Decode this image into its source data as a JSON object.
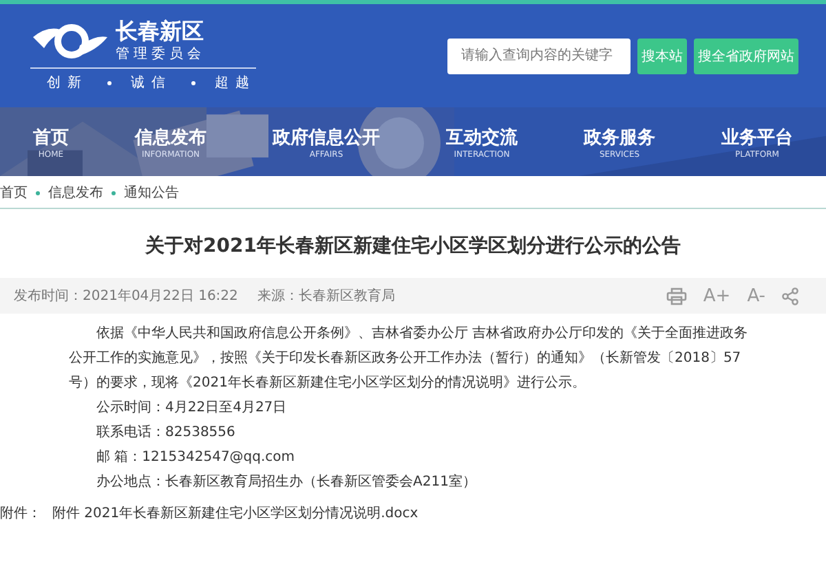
{
  "header": {
    "logo_title": "长春新区",
    "logo_subtitle": "管理委员会",
    "motto": [
      "创新",
      "诚信",
      "超越"
    ],
    "search": {
      "placeholder": "请输入查询内容的关键字"
    },
    "buttons": [
      "搜本站",
      "搜全省政府网站"
    ]
  },
  "nav": [
    {
      "label": "首页",
      "english": "HOME"
    },
    {
      "label": "信息发布",
      "english": "INFORMATION"
    },
    {
      "label": "政府信息公开",
      "english": "AFFAIRS"
    },
    {
      "label": "互动交流",
      "english": "INTERACTION"
    },
    {
      "label": "政务服务",
      "english": "SERVICES"
    },
    {
      "label": "业务平台",
      "english": "PLATFORM"
    }
  ],
  "breadcrumb": [
    "首页",
    "信息发布",
    "通知公告"
  ],
  "article": {
    "title": "关于对2021年长春新区新建住宅小区学区划分进行公示的公告",
    "meta": {
      "published": "发布时间：2021年04月22日 16:22",
      "source": "来源：长春新区教育局"
    },
    "tools": [
      "A+",
      "A-"
    ],
    "paragraph": "依据《中华人民共和国政府信息公开条例》、吉林省委办公厅 吉林省政府办公厅印发的《关于全面推进政务公开工作的实施意见》，按照《关于印发长春新区政务公开工作办法（暂行）的通知》（长新管发〔2018〕57号）的要求，现将《2021年长春新区新建住宅小区学区划分的情况说明》进行公示。",
    "details": [
      "公示时间：4月22日至4月27日",
      "联系电话：82538556",
      "邮 箱：1215342547@qq.com",
      "办公地点：长春新区教育局招生办（长春新区管委会A211室）"
    ],
    "attachment": {
      "label": "附件：",
      "link": "附件 2021年长春新区新建住宅小区学区划分情况说明.docx"
    }
  }
}
